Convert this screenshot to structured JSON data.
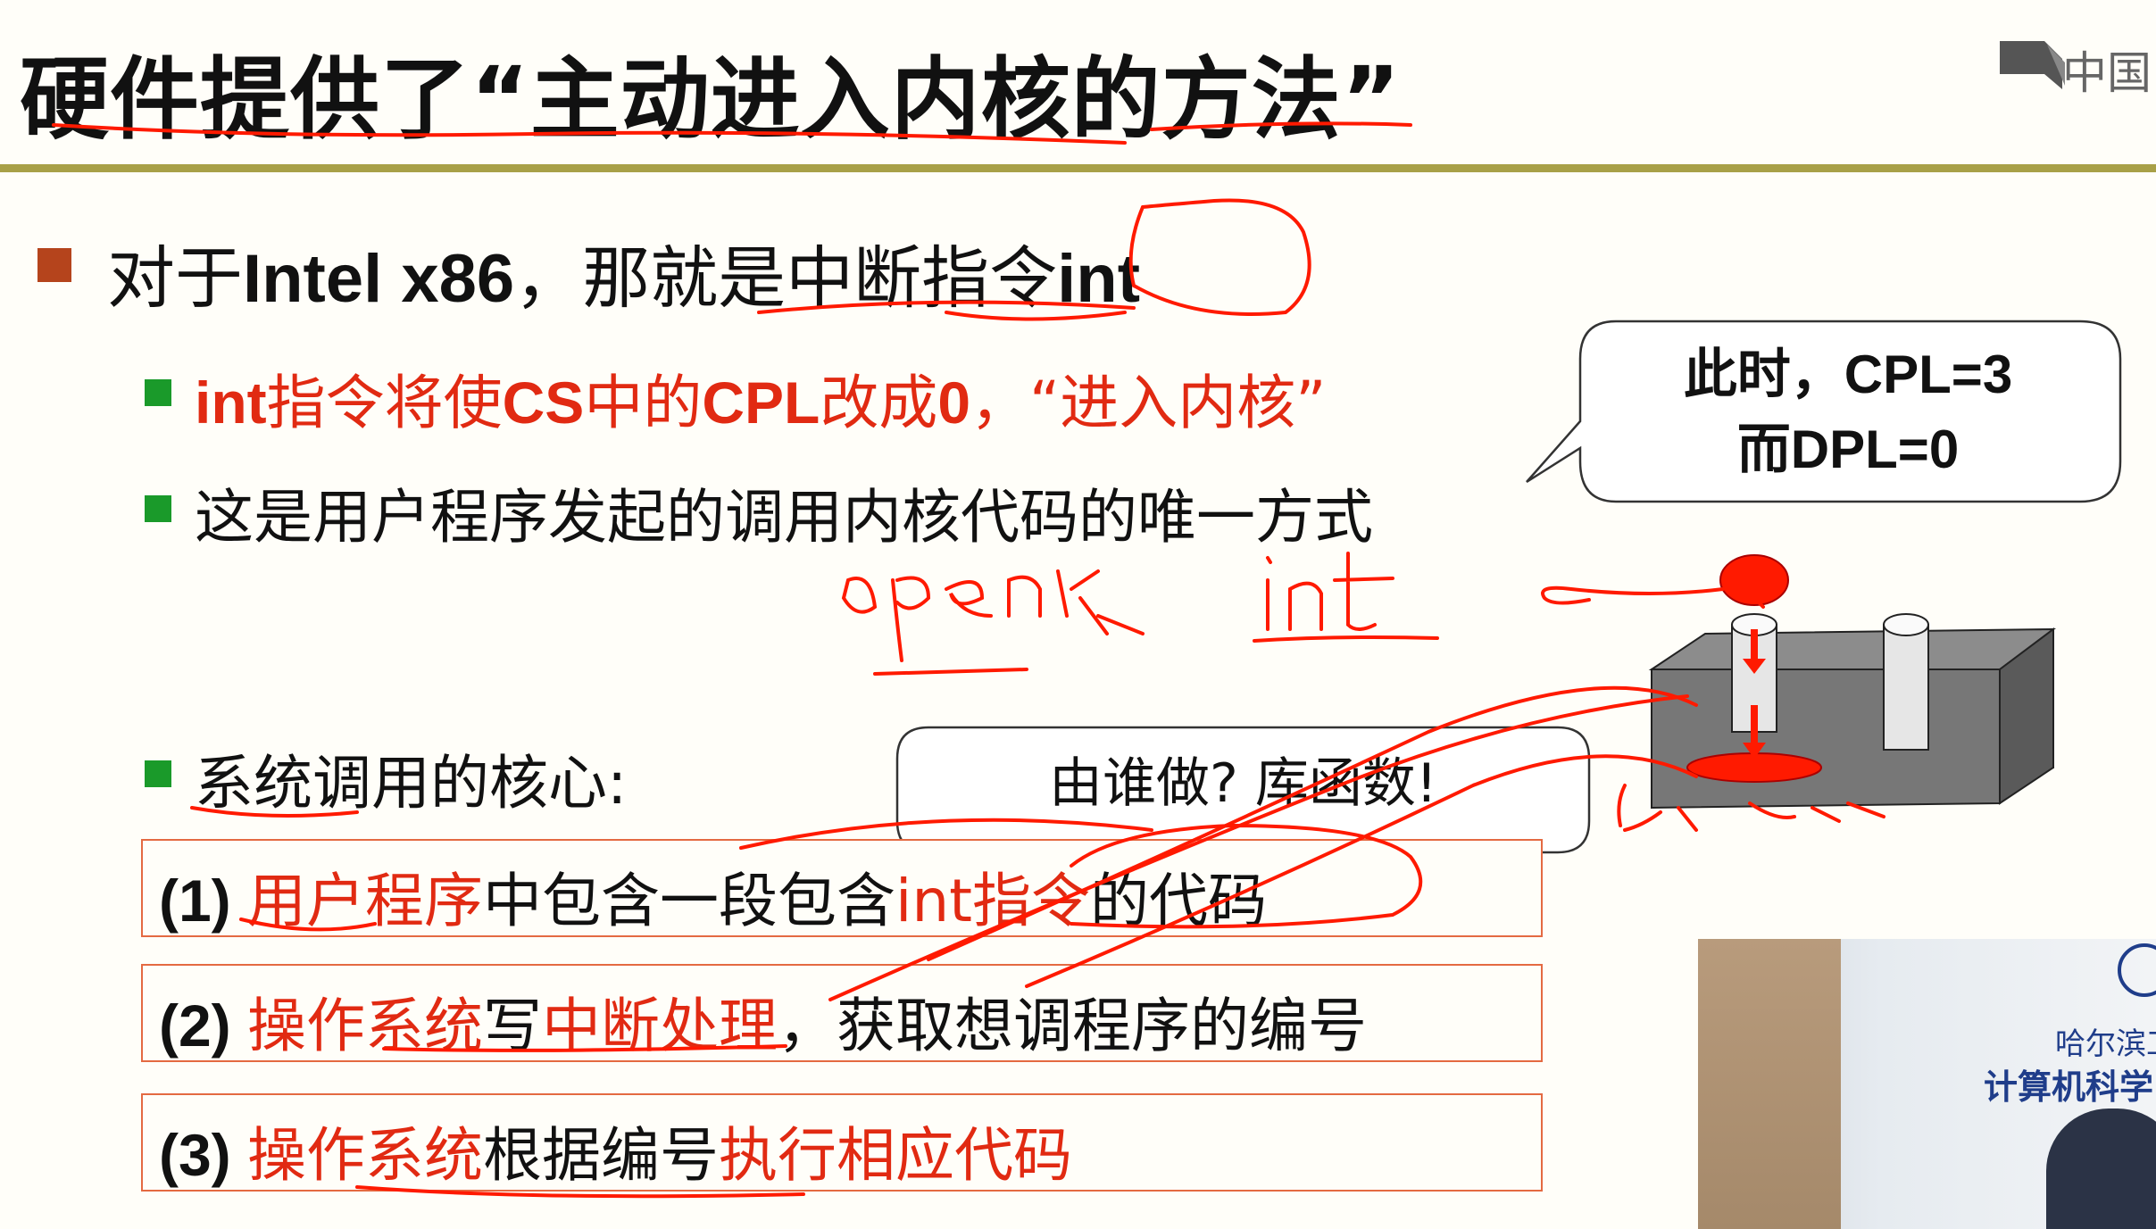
{
  "title": "硬件提供了“主动进入内核的方法”",
  "logo_text": "中国",
  "bullet1": {
    "prefix": "对于",
    "bold": "Intel x86",
    "suffix": "，那就是中断指令",
    "int": "int"
  },
  "sub1": {
    "seg1": "int",
    "seg2": "指令将使",
    "seg3": "CS",
    "seg4": "中的",
    "seg5": "CPL",
    "seg6": "改成",
    "seg7": "0",
    "seg8": "，“进入内核”"
  },
  "sub2": "这是用户程序发起的调用内核代码的唯一方式",
  "callout_top": {
    "line1": "此时，CPL=3",
    "line2": "而DPL=0"
  },
  "sub3": "系统调用的核心:",
  "callout_mid": "由谁做? 库函数!",
  "steps": [
    {
      "num": "(1) ",
      "red1": "用户程序",
      "black1": "中包含一段包含",
      "red2": "int指令",
      "black2": "的代码"
    },
    {
      "num": "(2) ",
      "red1": "操作系统",
      "black1": "写",
      "red2": "中断处理",
      "black2": "，获取想调程序的编号"
    },
    {
      "num": "(3) ",
      "red1": "操作系统",
      "black1": "根据编号",
      "red2": "执行相应代码",
      "black2": ""
    }
  ],
  "video": {
    "line1": "哈尔滨工",
    "line2": "计算机科学"
  },
  "colors": {
    "accent_red": "#e12a12",
    "rule": "#a8a048",
    "bullet_brown": "#b5441c",
    "bullet_green": "#1a9a2a",
    "box_border": "#e46a42"
  }
}
